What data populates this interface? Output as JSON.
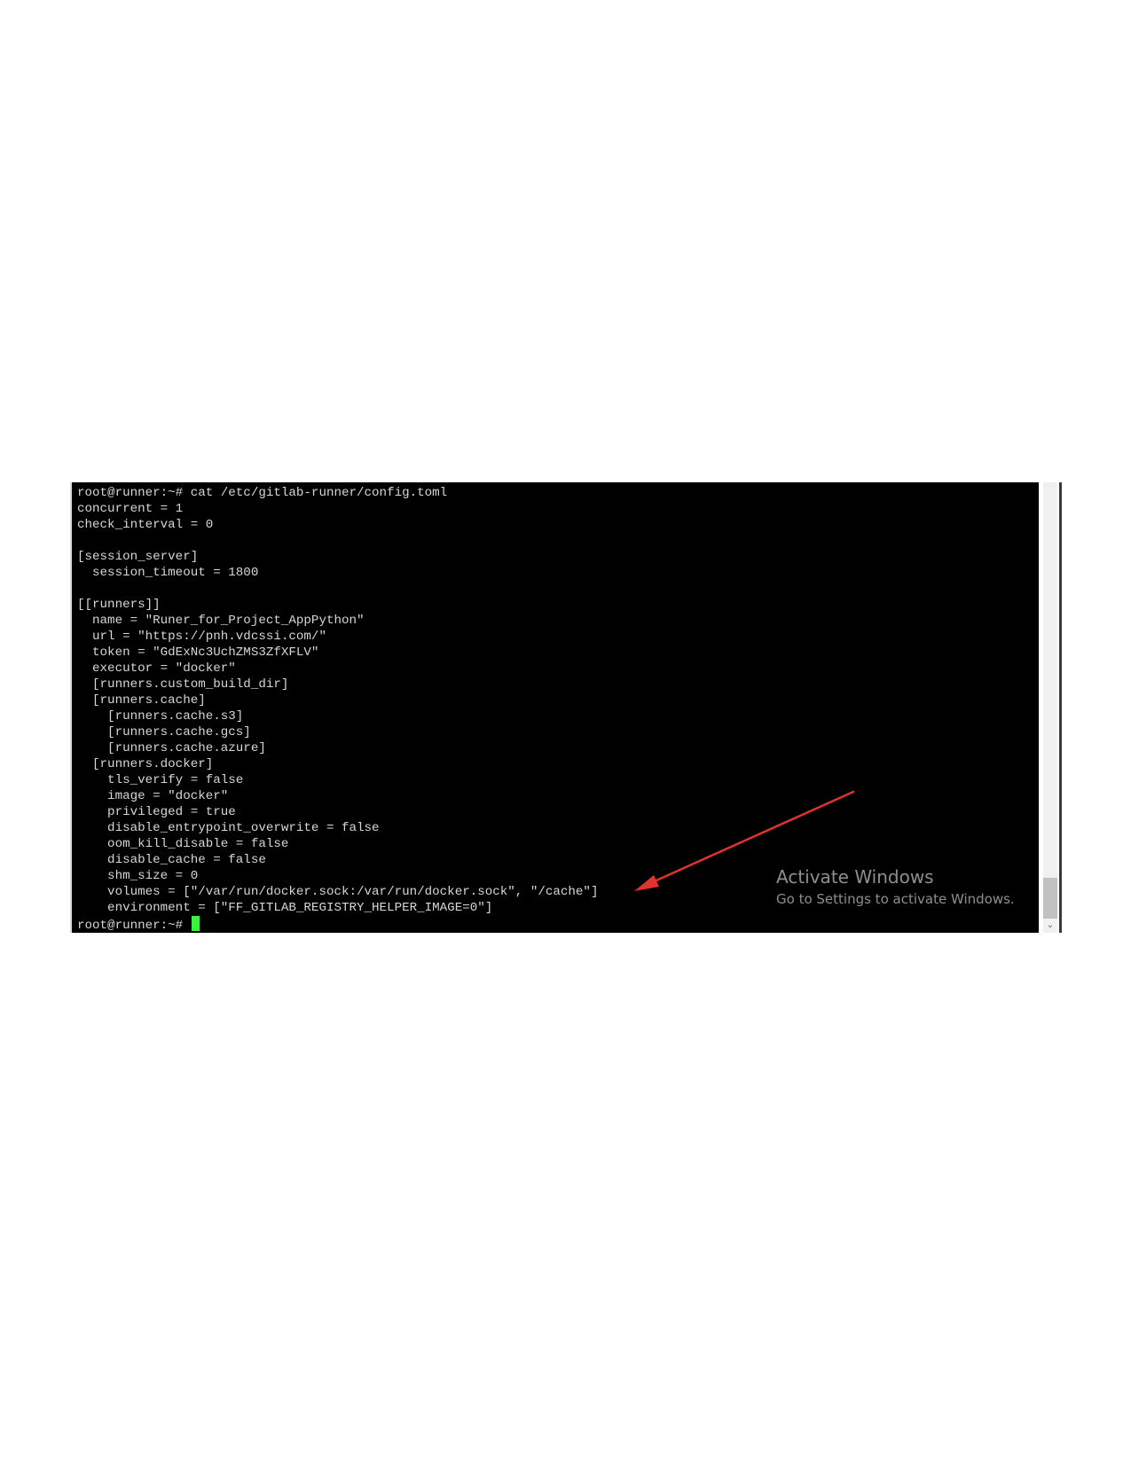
{
  "terminal": {
    "lines": [
      "root@runner:~# cat /etc/gitlab-runner/config.toml",
      "concurrent = 1",
      "check_interval = 0",
      "",
      "[session_server]",
      "  session_timeout = 1800",
      "",
      "[[runners]]",
      "  name = \"Runer_for_Project_AppPython\"",
      "  url = \"https://pnh.vdcssi.com/\"",
      "  token = \"GdExNc3UchZMS3ZfXFLV\"",
      "  executor = \"docker\"",
      "  [runners.custom_build_dir]",
      "  [runners.cache]",
      "    [runners.cache.s3]",
      "    [runners.cache.gcs]",
      "    [runners.cache.azure]",
      "  [runners.docker]",
      "    tls_verify = false",
      "    image = \"docker\"",
      "    privileged = true",
      "    disable_entrypoint_overwrite = false",
      "    oom_kill_disable = false",
      "    disable_cache = false",
      "    shm_size = 0",
      "    volumes = [\"/var/run/docker.sock:/var/run/docker.sock\", \"/cache\"]",
      "    environment = [\"FF_GITLAB_REGISTRY_HELPER_IMAGE=0\"]"
    ],
    "prompt": "root@runner:~# ",
    "cursor_color": "#3df03d",
    "text_color": "#d6d6d6",
    "background_color": "#000000"
  },
  "watermark": {
    "title": "Activate Windows",
    "subtitle": "Go to Settings to activate Windows."
  },
  "annotation": {
    "arrow_color": "#e0332b",
    "arrow_points_to": "volumes line"
  },
  "scrollbar": {
    "down_icon": "chevron-down-icon"
  }
}
